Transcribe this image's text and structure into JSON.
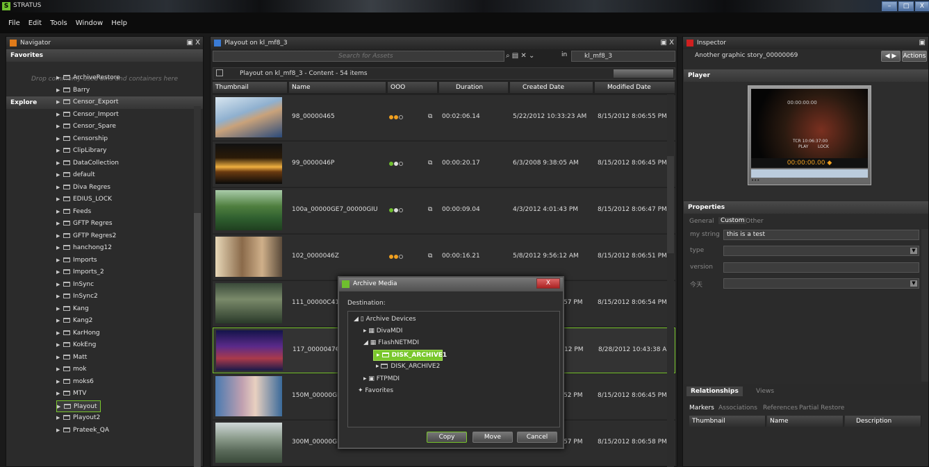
{
  "app": {
    "title": "STRATUS",
    "logo": "S"
  },
  "window_controls": {
    "minimize": "–",
    "maximize": "□",
    "close": "X"
  },
  "menu": [
    "File",
    "Edit",
    "Tools",
    "Window",
    "Help"
  ],
  "navigator": {
    "title": "Navigator",
    "favorites_label": "Favorites",
    "favorites_hint": "Drop commonly used bins and containers here",
    "explore_label": "Explore",
    "items": [
      "ArchiveRestore",
      "Barry",
      "Censor_Export",
      "Censor_Import",
      "Censor_Spare",
      "Censorship",
      "ClipLibrary",
      "DataCollection",
      "default",
      "Diva Regres",
      "EDIUS_LOCK",
      "Feeds",
      "GFTP Regres",
      "GFTP Regres2",
      "hanchong12",
      "Imports",
      "Imports_2",
      "InSync",
      "InSync2",
      "Kang",
      "Kang2",
      "KarHong",
      "KokEng",
      "Matt",
      "mok",
      "moks6",
      "MTV",
      "Playout",
      "Playout2",
      "Prateek_QA"
    ],
    "selected": "Playout"
  },
  "center": {
    "title": "Playout on kl_mf8_3",
    "search_placeholder": "Search for Assets",
    "scope_in": "in",
    "scope_value": "kl_mf8_3",
    "content_title": "Playout on kl_mf8_3  -  Content  -  54 items",
    "columns": {
      "thumbnail": "Thumbnail",
      "name": "Name",
      "status": "OOO",
      "duration": "Duration",
      "created": "Created Date",
      "modified": "Modified Date"
    },
    "rows": [
      {
        "name": "98_00000465",
        "duration": "00:02:06.14",
        "created": "5/22/2012 10:33:23 AM",
        "modified": "8/15/2012 8:06:55 PM"
      },
      {
        "name": "99_0000046P",
        "duration": "00:00:20.17",
        "created": "6/3/2008 9:38:05 AM",
        "modified": "8/15/2012 8:06:45 PM"
      },
      {
        "name": "100a_00000GE7_00000GIU",
        "duration": "00:00:09.04",
        "created": "4/3/2012 4:01:43 PM",
        "modified": "8/15/2012 8:06:47 PM"
      },
      {
        "name": "102_0000046Z",
        "duration": "00:00:16.21",
        "created": "5/8/2012 9:56:12 AM",
        "modified": "8/15/2012 8:06:51 PM"
      },
      {
        "name": "111_00000C41",
        "duration": "",
        "created": ":57 PM",
        "modified": "8/15/2012 8:06:54 PM"
      },
      {
        "name": "117_0000047€",
        "duration": "",
        "created": ":12 PM",
        "modified": "8/28/2012 10:43:38 A"
      },
      {
        "name": "150M_00000GI",
        "duration": "",
        "created": ":52 PM",
        "modified": "8/15/2012 8:06:45 PM"
      },
      {
        "name": "300M_00000GI",
        "duration": "",
        "created": ":57 PM",
        "modified": "8/15/2012 8:06:58 PM"
      }
    ]
  },
  "dialog": {
    "title": "Archive Media",
    "destination_label": "Destination:",
    "root": "Archive Devices",
    "devices": [
      "DivaMDI",
      "FlashNETMDI",
      "FTPMDI"
    ],
    "flash_children": [
      "DISK_ARCHIVE1",
      "DISK_ARCHIVE2"
    ],
    "favorites": "Favorites",
    "buttons": {
      "copy": "Copy",
      "move": "Move",
      "cancel": "Cancel"
    },
    "close": "X"
  },
  "inspector": {
    "title": "Inspector",
    "story": "Another graphic story_00000069",
    "actions": "Actions",
    "player_label": "Player",
    "tc_top": "00:00:00:00",
    "tcr": "TCR 10:06:37:00",
    "play": "PLAY",
    "lock": "LOCK",
    "timecode": "00:00:00.00",
    "scrub_dots": "•••",
    "properties_label": "Properties",
    "prop_tabs": [
      "General",
      "Custom",
      "Other"
    ],
    "fields": {
      "my_string_label": "my string",
      "my_string_value": "this is a test",
      "type_label": "type",
      "version_label": "version",
      "today_label": "今天"
    },
    "rel_tabs": [
      "Relationships",
      "Views"
    ],
    "marker_tabs": [
      "Markers",
      "Associations",
      "References",
      "Partial Restore"
    ],
    "marker_cols": [
      "Thumbnail",
      "Name",
      "Description"
    ]
  },
  "colors": {
    "accent_green": "#6fbf2e",
    "highlight": "#79c72c",
    "titlebar_blue": "#4d6f9f"
  }
}
